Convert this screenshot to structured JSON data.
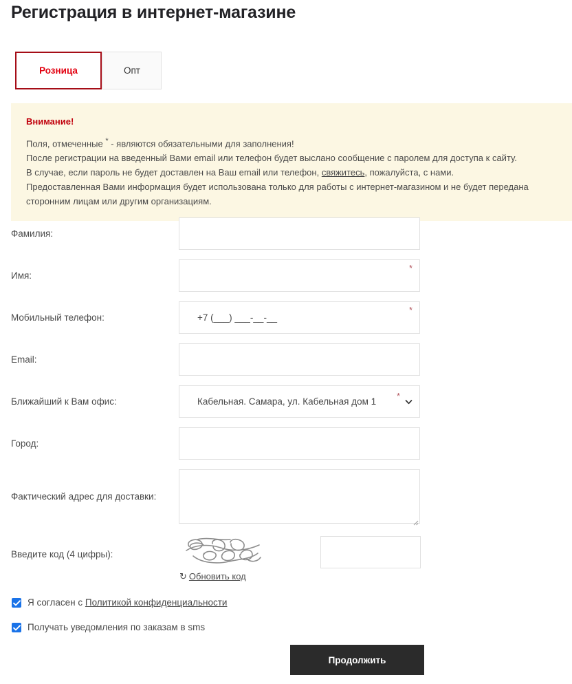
{
  "page_title": "Регистрация в интернет-магазине",
  "tabs": [
    {
      "label": "Розница",
      "active": true
    },
    {
      "label": "Опт",
      "active": false
    }
  ],
  "notice": {
    "title": "Внимание!",
    "line1_before": "Поля, отмеченные ",
    "line1_star": "*",
    "line1_after": " - являются обязательными для заполнения!",
    "line2": "После регистрации на введенный Вами email или телефон будет выслано сообщение с паролем для доступа к сайту.",
    "line3_before": "В случае, если пароль не будет доставлен на Ваш email или телефон, ",
    "line3_link": "свяжитесь",
    "line3_after": ", пожалуйста, с нами.",
    "line4": "Предоставленная Вами информация будет использована только для работы с интернет-магазином и не будет передана сторонним лицам или другим организациям."
  },
  "fields": {
    "lastname": {
      "label": "Фамилия:",
      "value": "",
      "required": false
    },
    "firstname": {
      "label": "Имя:",
      "value": "",
      "required": true,
      "star": "*"
    },
    "phone": {
      "label": "Мобильный телефон:",
      "value": "+7 (___) ___-__-__",
      "required": true,
      "star": "*"
    },
    "email": {
      "label": "Email:",
      "value": "",
      "required": false
    },
    "office": {
      "label": "Ближайший к Вам офис:",
      "selected": "Кабельная. Самара, ул. Кабельная дом 1",
      "required": true,
      "star": "*"
    },
    "city": {
      "label": "Город:",
      "value": "",
      "required": false
    },
    "address": {
      "label": "Фактический адрес для доставки:",
      "value": "",
      "required": false
    },
    "captcha": {
      "label": "Введите код (4 цифры):",
      "value": "",
      "refresh_label": "Обновить код",
      "refresh_icon": "refresh-icon"
    }
  },
  "checkboxes": [
    {
      "checked": true,
      "before": "Я согласен с ",
      "link": "Политикой конфиденциальности",
      "after": ""
    },
    {
      "checked": true,
      "before": "Получать уведомления по заказам в sms",
      "link": "",
      "after": ""
    }
  ],
  "submit": {
    "label": "Продолжить"
  },
  "colors": {
    "accent_red": "#e2000f",
    "tab_border": "#a50d17",
    "notice_bg": "#fcf7e3",
    "notice_title": "#c0000c",
    "checkbox_blue": "#1a73e8",
    "button_bg": "#2b2b2b",
    "required_star": "#b3575f"
  }
}
